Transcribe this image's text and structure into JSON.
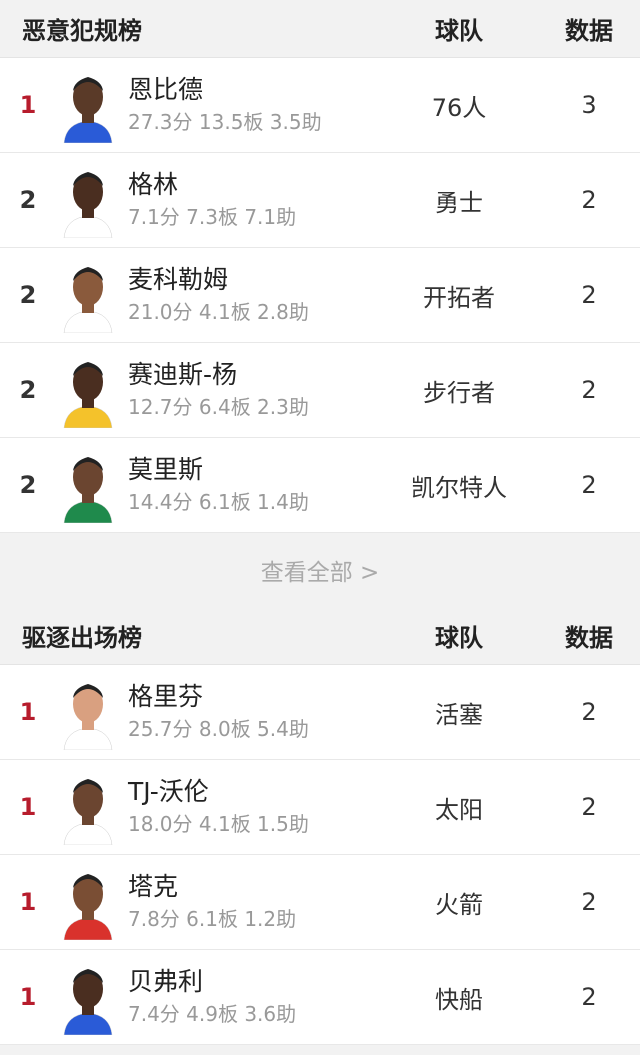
{
  "fouls": {
    "title": "恶意犯规榜",
    "team_header": "球队",
    "data_header": "数据",
    "rows": [
      {
        "rank": "1",
        "name": "恩比德",
        "stats": "27.3分 13.5板 3.5助",
        "team": "76人",
        "value": "3"
      },
      {
        "rank": "2",
        "name": "格林",
        "stats": "7.1分 7.3板 7.1助",
        "team": "勇士",
        "value": "2"
      },
      {
        "rank": "2",
        "name": "麦科勒姆",
        "stats": "21.0分 4.1板 2.8助",
        "team": "开拓者",
        "value": "2"
      },
      {
        "rank": "2",
        "name": "赛迪斯-杨",
        "stats": "12.7分 6.4板 2.3助",
        "team": "步行者",
        "value": "2"
      },
      {
        "rank": "2",
        "name": "莫里斯",
        "stats": "14.4分 6.1板 1.4助",
        "team": "凯尔特人",
        "value": "2"
      }
    ],
    "view_all": "查看全部 >"
  },
  "ejections": {
    "title": "驱逐出场榜",
    "team_header": "球队",
    "data_header": "数据",
    "rows": [
      {
        "rank": "1",
        "name": "格里芬",
        "stats": "25.7分 8.0板 5.4助",
        "team": "活塞",
        "value": "2"
      },
      {
        "rank": "1",
        "name": "TJ-沃伦",
        "stats": "18.0分 4.1板 1.5助",
        "team": "太阳",
        "value": "2"
      },
      {
        "rank": "1",
        "name": "塔克",
        "stats": "7.8分 6.1板 1.2助",
        "team": "火箭",
        "value": "2"
      },
      {
        "rank": "1",
        "name": "贝弗利",
        "stats": "7.4分 4.9板 3.6助",
        "team": "快船",
        "value": "2"
      }
    ]
  },
  "colors": {
    "rank_top": "#b71c2c",
    "stats_gray": "#999999",
    "background": "#f2f2f2"
  }
}
